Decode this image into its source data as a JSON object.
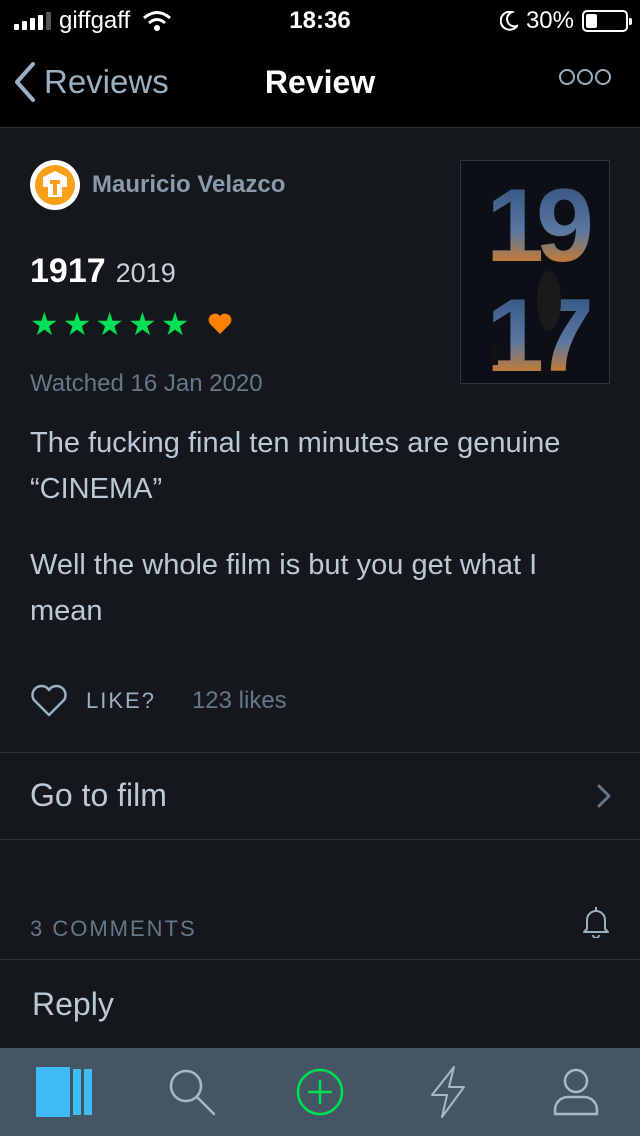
{
  "status_bar": {
    "carrier": "giffgaff",
    "time": "18:36",
    "battery": "30%"
  },
  "nav": {
    "back_label": "Reviews",
    "title": "Review"
  },
  "review": {
    "author": "Mauricio Velazco",
    "film_title": "1917",
    "film_year": "2019",
    "stars": 5,
    "liked": true,
    "watched": "Watched 16 Jan 2020",
    "body": [
      "The fucking final ten minutes are genuine “CINEMA”",
      "Well the whole film is but you get what I mean"
    ],
    "like_label": "LIKE?",
    "like_count": "123 likes"
  },
  "goto_film": {
    "label": "Go to film"
  },
  "comments": {
    "header": "3 COMMENTS",
    "reply_label": "Reply"
  },
  "colors": {
    "star": "#00e054",
    "heart": "#ff8000",
    "add": "#00e054",
    "diary_tab": "#40bcf4"
  },
  "tabs": [
    {
      "icon": "diary-icon"
    },
    {
      "icon": "search-icon"
    },
    {
      "icon": "add-icon"
    },
    {
      "icon": "activity-icon"
    },
    {
      "icon": "profile-icon"
    }
  ]
}
